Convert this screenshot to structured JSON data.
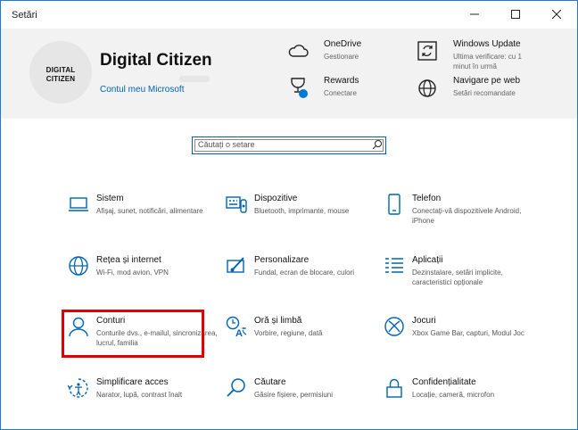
{
  "window": {
    "title": "Setări"
  },
  "profile": {
    "name": "Digital Citizen",
    "avatar_line1": "DIGITAL",
    "avatar_line2": "CITIZEN",
    "account_link": "Contul meu Microsoft"
  },
  "header_items": [
    {
      "title": "OneDrive",
      "sub": "Gestionare",
      "icon": "cloud-icon"
    },
    {
      "title": "Windows Update",
      "sub": "Ultima verificare: cu 1",
      "sub2": "minut în urmă",
      "icon": "refresh-icon"
    },
    {
      "title": "Rewards",
      "sub": "Conectare",
      "icon": "trophy-icon"
    },
    {
      "title": "Navigare pe web",
      "sub": "Setări recomandate",
      "icon": "globe-icon"
    }
  ],
  "search": {
    "placeholder": "Căutați o setare"
  },
  "tiles": [
    {
      "title": "Sistem",
      "desc": "Afișaj, sunet, notificări, alimentare",
      "icon": "laptop-icon"
    },
    {
      "title": "Dispozitive",
      "desc": "Bluetooth, imprimante, mouse",
      "icon": "keyboard-icon"
    },
    {
      "title": "Telefon",
      "desc": "Conectați-vă dispozitivele Android, iPhone",
      "icon": "phone-icon"
    },
    {
      "title": "Rețea și internet",
      "desc": "Wi-Fi, mod avion, VPN",
      "icon": "globe-icon"
    },
    {
      "title": "Personalizare",
      "desc": "Fundal, ecran de blocare, culori",
      "icon": "paintbrush-icon"
    },
    {
      "title": "Aplicații",
      "desc": "Dezinstalare, setări implicite, caracteristici opționale",
      "icon": "apps-list-icon"
    },
    {
      "title": "Conturi",
      "desc": "Conturile dvs., e-mailul, sincronizarea, lucrul, familia",
      "icon": "person-icon"
    },
    {
      "title": "Oră și limbă",
      "desc": "Vorbire, regiune, dată",
      "icon": "time-language-icon"
    },
    {
      "title": "Jocuri",
      "desc": "Xbox Game Bar, capturi, Modul Joc",
      "icon": "xbox-icon"
    },
    {
      "title": "Simplificare acces",
      "desc": "Narator, lupă, contrast înalt",
      "icon": "ease-of-access-icon"
    },
    {
      "title": "Căutare",
      "desc": "Găsire fișiere, permisiuni",
      "icon": "search-icon"
    },
    {
      "title": "Confidențialitate",
      "desc": "Locație, cameră, microfon",
      "icon": "lock-icon"
    }
  ],
  "colors": {
    "accent": "#0063b1",
    "highlight": "#e10000",
    "header_bg": "#f2f2f2"
  }
}
